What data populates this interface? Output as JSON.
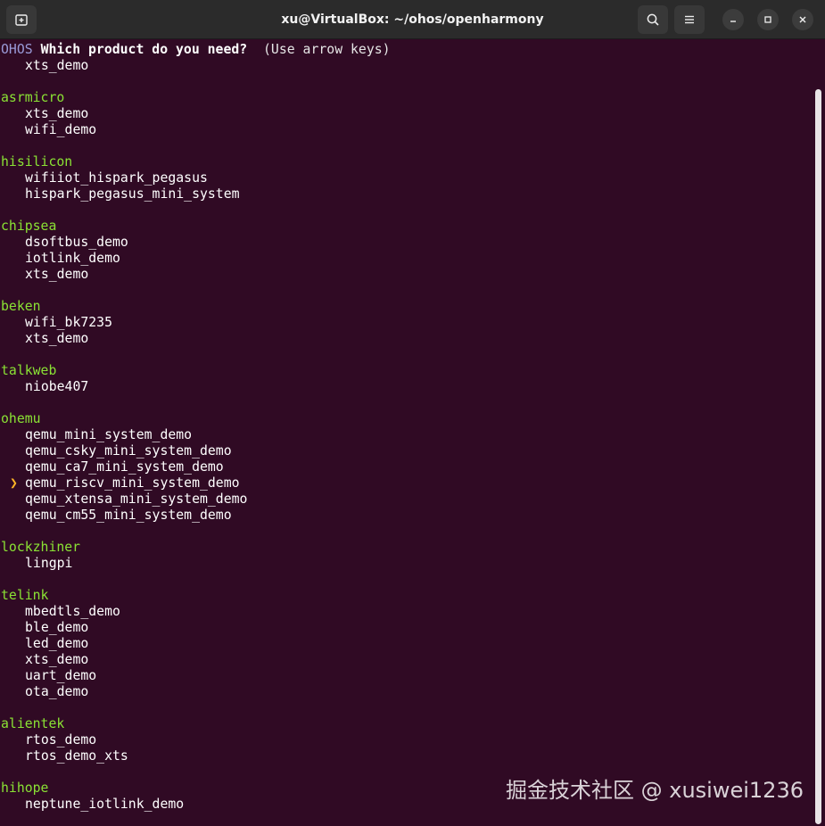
{
  "window": {
    "title": "xu@VirtualBox: ~/ohos/openharmony"
  },
  "titlebar_icons": {
    "new_tab": "new-tab-icon",
    "search": "search-icon",
    "menu": "hamburger-menu-icon",
    "minimize": "minimize-icon",
    "maximize": "maximize-icon",
    "close": "close-icon"
  },
  "prompt": {
    "prefix": "OHOS",
    "question": "Which product do you need?",
    "hint": "(Use arrow keys)"
  },
  "selection": {
    "pointer": "❯",
    "selected_product": "qemu_riscv_mini_system_demo"
  },
  "groups": [
    {
      "vendor": "",
      "products": [
        "xts_demo"
      ]
    },
    {
      "vendor": "asrmicro",
      "products": [
        "xts_demo",
        "wifi_demo"
      ]
    },
    {
      "vendor": "hisilicon",
      "products": [
        "wifiiot_hispark_pegasus",
        "hispark_pegasus_mini_system"
      ]
    },
    {
      "vendor": "chipsea",
      "products": [
        "dsoftbus_demo",
        "iotlink_demo",
        "xts_demo"
      ]
    },
    {
      "vendor": "beken",
      "products": [
        "wifi_bk7235",
        "xts_demo"
      ]
    },
    {
      "vendor": "talkweb",
      "products": [
        "niobe407"
      ]
    },
    {
      "vendor": "ohemu",
      "products": [
        "qemu_mini_system_demo",
        "qemu_csky_mini_system_demo",
        "qemu_ca7_mini_system_demo",
        "qemu_riscv_mini_system_demo",
        "qemu_xtensa_mini_system_demo",
        "qemu_cm55_mini_system_demo"
      ]
    },
    {
      "vendor": "lockzhiner",
      "products": [
        "lingpi"
      ]
    },
    {
      "vendor": "telink",
      "products": [
        "mbedtls_demo",
        "ble_demo",
        "led_demo",
        "xts_demo",
        "uart_demo",
        "ota_demo"
      ]
    },
    {
      "vendor": "alientek",
      "products": [
        "rtos_demo",
        "rtos_demo_xts"
      ]
    },
    {
      "vendor": "hihope",
      "products": [
        "neptune_iotlink_demo"
      ]
    }
  ],
  "watermark": "掘金技术社区 @ xusiwei1236",
  "colors": {
    "background": "#300a24",
    "vendor": "#8ae234",
    "pointer": "#fcb426",
    "prefix": "#9a9ad8"
  }
}
